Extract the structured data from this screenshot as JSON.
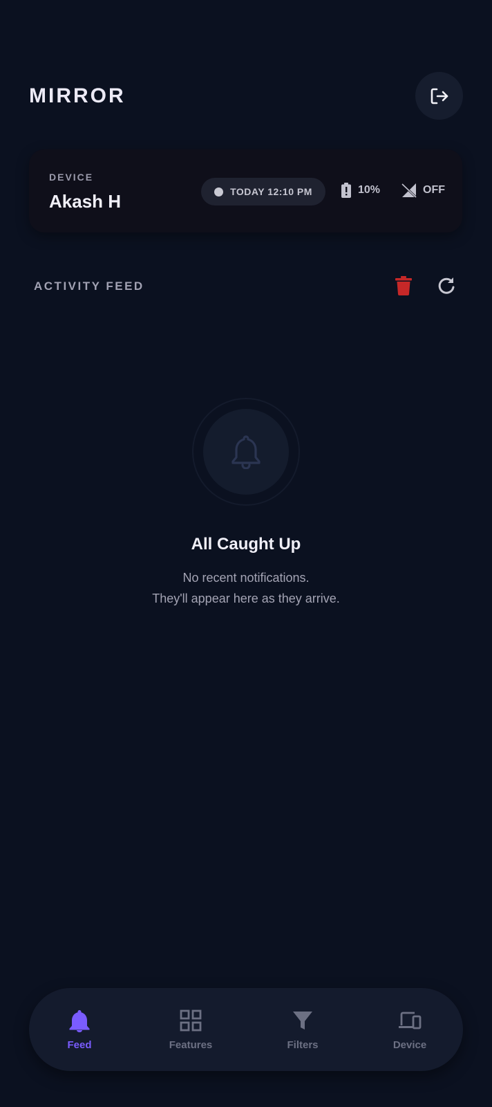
{
  "header": {
    "title": "MIRROR",
    "logout_icon": "logout-icon"
  },
  "device_card": {
    "label": "DEVICE",
    "name": "Akash H",
    "last_seen": "TODAY 12:10 PM",
    "battery": "10%",
    "signal": "OFF"
  },
  "activity": {
    "title": "ACTIVITY FEED",
    "clear_icon": "trash-icon",
    "refresh_icon": "refresh-icon"
  },
  "empty_state": {
    "title": "All Caught Up",
    "line1": "No recent notifications.",
    "line2": "They'll appear here as they arrive."
  },
  "nav": {
    "items": [
      {
        "label": "Feed",
        "icon": "bell-icon",
        "active": true
      },
      {
        "label": "Features",
        "icon": "grid-icon",
        "active": false
      },
      {
        "label": "Filters",
        "icon": "filter-icon",
        "active": false
      },
      {
        "label": "Device",
        "icon": "devices-icon",
        "active": false
      }
    ]
  },
  "colors": {
    "background": "#0b1120",
    "accent": "#7a5cff",
    "danger": "#c62828",
    "muted": "#6c7083"
  }
}
